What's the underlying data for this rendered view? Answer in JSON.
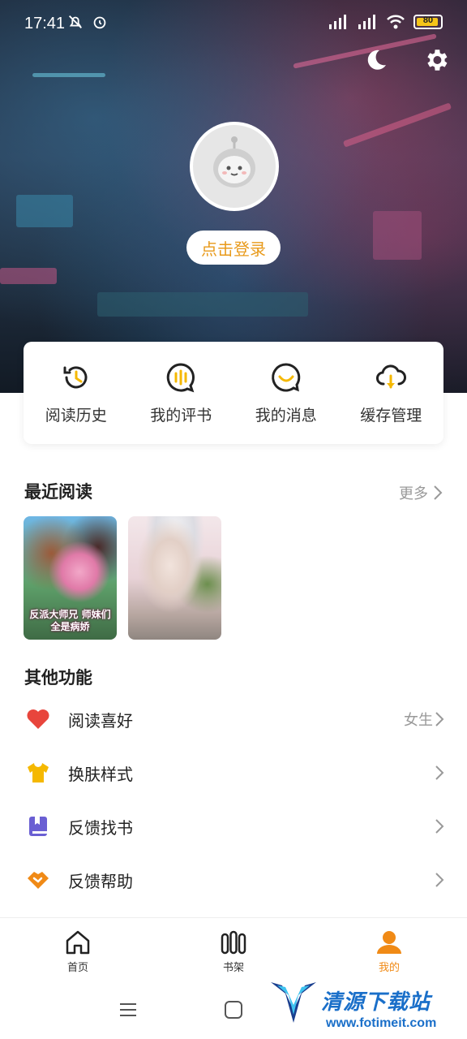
{
  "status_bar": {
    "time": "17:41",
    "battery": "80"
  },
  "header": {
    "login_label": "点击登录"
  },
  "quick_actions": [
    {
      "label": "阅读历史",
      "icon": "history-icon"
    },
    {
      "label": "我的评书",
      "icon": "comment-book-icon"
    },
    {
      "label": "我的消息",
      "icon": "message-icon"
    },
    {
      "label": "缓存管理",
      "icon": "cloud-download-icon"
    }
  ],
  "recent": {
    "title": "最近阅读",
    "more_label": "更多",
    "books": [
      {
        "cover_text": "反派大师兄 师妹们全是病娇"
      },
      {
        "cover_text": ""
      }
    ]
  },
  "other": {
    "title": "其他功能",
    "items": [
      {
        "label": "阅读喜好",
        "value": "女生",
        "icon": "heart-icon",
        "color": "#e8453c"
      },
      {
        "label": "换肤样式",
        "value": "",
        "icon": "tshirt-icon",
        "color": "#f5b800"
      },
      {
        "label": "反馈找书",
        "value": "",
        "icon": "book-icon",
        "color": "#6a5fd3"
      },
      {
        "label": "反馈帮助",
        "value": "",
        "icon": "handshake-icon",
        "color": "#f08a16"
      }
    ]
  },
  "bottom_nav": [
    {
      "label": "首页",
      "icon": "home-icon",
      "active": false
    },
    {
      "label": "书架",
      "icon": "bookshelf-icon",
      "active": false
    },
    {
      "label": "我的",
      "icon": "user-icon",
      "active": true
    }
  ],
  "watermark": {
    "title": "清源下载站",
    "url": "www.fotimeit.com"
  },
  "colors": {
    "accent": "#f08a16",
    "login_text": "#e89a1b"
  }
}
